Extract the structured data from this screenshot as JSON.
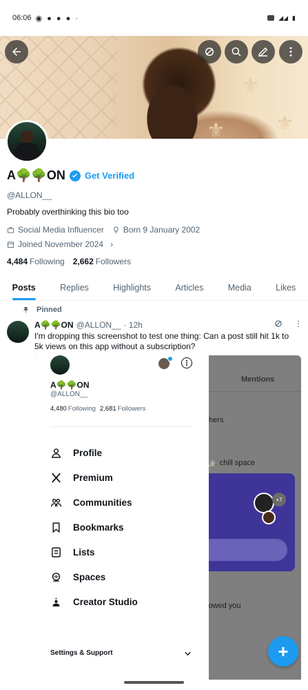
{
  "status_bar": {
    "time": "06:06"
  },
  "profile": {
    "name": "A🌳🌳ON",
    "get_verified": "Get Verified",
    "handle": "@ALLON__",
    "bio": "Probably overthinking this bio too",
    "category": "Social Media Influencer",
    "born": "Born 9 January 2002",
    "joined": "Joined November 2024",
    "following_count": "4,484",
    "following_label": "Following",
    "followers_count": "2,662",
    "followers_label": "Followers"
  },
  "tabs": [
    {
      "label": "Posts",
      "active": true
    },
    {
      "label": "Replies"
    },
    {
      "label": "Highlights"
    },
    {
      "label": "Articles"
    },
    {
      "label": "Media"
    },
    {
      "label": "Likes"
    }
  ],
  "pinned_post": {
    "pinned_label": "Pinned",
    "author_name": "A🌳🌳ON",
    "author_handle": "@ALLON__",
    "time": "· 12h",
    "text": "I'm dropping this screenshot to test one thing: Can a post still hit 1k to 5k views on this app without a subscription?"
  },
  "drawer": {
    "name": "A🌳🌳ON",
    "handle": "@ALLON__",
    "following_count": "4,480",
    "following_label": "Following",
    "followers_count": "2,681",
    "followers_label": "Followers",
    "menu": [
      {
        "label": "Profile",
        "icon": "person-icon"
      },
      {
        "label": "Premium",
        "icon": "x-logo-icon"
      },
      {
        "label": "Communities",
        "icon": "communities-icon"
      },
      {
        "label": "Bookmarks",
        "icon": "bookmark-icon"
      },
      {
        "label": "Lists",
        "icon": "list-icon"
      },
      {
        "label": "Spaces",
        "icon": "spaces-icon"
      },
      {
        "label": "Creator Studio",
        "icon": "creator-studio-icon"
      }
    ],
    "settings_label": "Settings & Support"
  },
  "background": {
    "mentions": "Mentions",
    "others": "thers",
    "chill": "chill space",
    "badge": "+7",
    "followed": "lowed you"
  },
  "colors": {
    "accent": "#1d9bf0",
    "community_card": "#3f3599"
  }
}
